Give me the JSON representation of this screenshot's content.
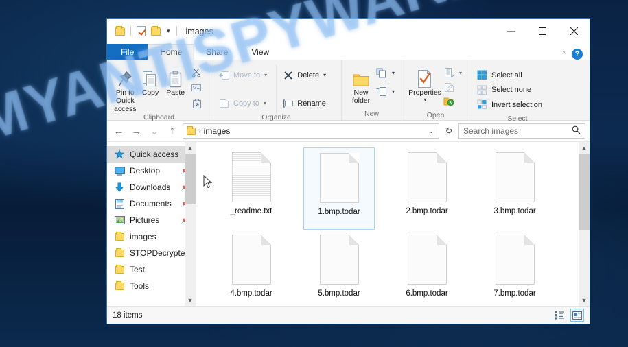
{
  "watermark": {
    "text": "MYANTISPYWARE.COM"
  },
  "window": {
    "title": "images",
    "quick_access_toolbar": [
      {
        "name": "folder-properties-icon",
        "label": "Properties"
      },
      {
        "name": "new-folder-icon",
        "label": "New folder"
      },
      {
        "name": "customize-toolbar-caret",
        "label": "▾"
      }
    ],
    "controls": {
      "minimize": "–",
      "maximize": "□",
      "close": "✕"
    },
    "ribbon_toggle": "^",
    "help": "?"
  },
  "tabs": [
    {
      "label": "File",
      "active": false,
      "is_file": true
    },
    {
      "label": "Home",
      "active": true,
      "is_file": false
    },
    {
      "label": "Share",
      "active": false,
      "is_file": false
    },
    {
      "label": "View",
      "active": false,
      "is_file": false
    }
  ],
  "ribbon": {
    "groups": [
      {
        "title": "Clipboard",
        "big_buttons": [
          {
            "label": "Pin to Quick access",
            "icon": "pin-icon"
          },
          {
            "label": "Copy",
            "icon": "copy-icon"
          },
          {
            "label": "Paste",
            "icon": "paste-icon"
          }
        ],
        "small_buttons": [
          {
            "label": "Cut",
            "icon": "scissors-icon"
          },
          {
            "label": "Copy path",
            "icon": "copy-path-icon"
          },
          {
            "label": "Paste shortcut",
            "icon": "paste-shortcut-icon"
          }
        ]
      },
      {
        "title": "Organize",
        "items": [
          {
            "label": "Move to",
            "icon": "move-to-icon",
            "has_caret": true,
            "disabled": true
          },
          {
            "label": "Copy to",
            "icon": "copy-to-icon",
            "has_caret": true,
            "disabled": true
          },
          {
            "label": "Delete",
            "icon": "delete-x-icon",
            "has_caret": true,
            "disabled": false
          },
          {
            "label": "Rename",
            "icon": "rename-icon",
            "has_caret": false,
            "disabled": false
          }
        ]
      },
      {
        "title": "New",
        "big_buttons": [
          {
            "label": "New folder",
            "icon": "new-folder-icon"
          }
        ],
        "small_buttons": [
          {
            "label": "New item",
            "icon": "new-item-icon"
          },
          {
            "label": "Easy access",
            "icon": "easy-access-icon"
          }
        ]
      },
      {
        "title": "Open",
        "big_buttons": [
          {
            "label": "Properties",
            "icon": "properties-icon"
          }
        ],
        "small_buttons": [
          {
            "label": "Open",
            "icon": "open-icon"
          },
          {
            "label": "Edit",
            "icon": "edit-icon"
          },
          {
            "label": "History",
            "icon": "history-icon"
          }
        ]
      },
      {
        "title": "Select",
        "items": [
          {
            "label": "Select all",
            "icon": "select-all-icon"
          },
          {
            "label": "Select none",
            "icon": "select-none-icon"
          },
          {
            "label": "Invert selection",
            "icon": "invert-selection-icon"
          }
        ]
      }
    ]
  },
  "address_bar": {
    "back": "←",
    "forward": "→",
    "recent": "⌄",
    "up": "↑",
    "path_folder_icon": "folder-icon",
    "separator": "›",
    "path": "images",
    "dropdown": "⌄",
    "refresh": "↻",
    "search_placeholder": "Search images"
  },
  "nav_pane": {
    "items": [
      {
        "label": "Quick access",
        "icon": "quick-access-star-icon",
        "selected": true,
        "pinned": false
      },
      {
        "label": "Desktop",
        "icon": "desktop-icon",
        "selected": false,
        "pinned": true
      },
      {
        "label": "Downloads",
        "icon": "downloads-arrow-icon",
        "selected": false,
        "pinned": true
      },
      {
        "label": "Documents",
        "icon": "documents-icon",
        "selected": false,
        "pinned": true
      },
      {
        "label": "Pictures",
        "icon": "pictures-icon",
        "selected": false,
        "pinned": true
      },
      {
        "label": "images",
        "icon": "folder-icon",
        "selected": false,
        "pinned": false
      },
      {
        "label": "STOPDecrypter",
        "icon": "folder-icon",
        "selected": false,
        "pinned": false
      },
      {
        "label": "Test",
        "icon": "folder-icon",
        "selected": false,
        "pinned": false
      },
      {
        "label": "Tools",
        "icon": "folder-icon",
        "selected": false,
        "pinned": false
      }
    ]
  },
  "files": [
    {
      "name": "_readme.txt",
      "icon": "text-document-icon",
      "selected": false
    },
    {
      "name": "1.bmp.todar",
      "icon": "blank-document-icon",
      "selected": true
    },
    {
      "name": "2.bmp.todar",
      "icon": "blank-document-icon",
      "selected": false
    },
    {
      "name": "3.bmp.todar",
      "icon": "blank-document-icon",
      "selected": false
    },
    {
      "name": "4.bmp.todar",
      "icon": "blank-document-icon",
      "selected": false
    },
    {
      "name": "5.bmp.todar",
      "icon": "blank-document-icon",
      "selected": false
    },
    {
      "name": "6.bmp.todar",
      "icon": "blank-document-icon",
      "selected": false
    },
    {
      "name": "7.bmp.todar",
      "icon": "blank-document-icon",
      "selected": false
    }
  ],
  "status_bar": {
    "item_count": "18 items",
    "view_buttons": [
      {
        "name": "details-view-button",
        "active": false
      },
      {
        "name": "large-icons-view-button",
        "active": true
      }
    ]
  },
  "colors": {
    "accent": "#136ec2",
    "desktop": "#0b2547",
    "selection": "#a9d4f5",
    "folder": "#fcd965"
  }
}
